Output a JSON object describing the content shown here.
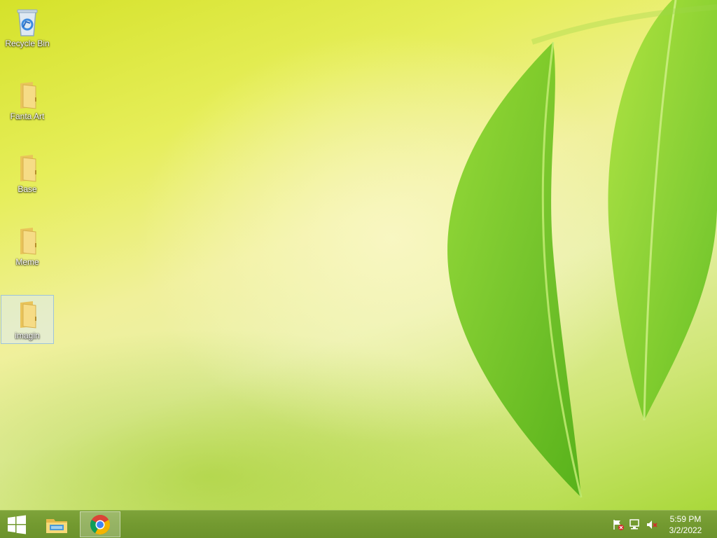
{
  "desktop": {
    "icons": [
      {
        "label": "Recycle Bin",
        "icon": "recycle-bin-icon",
        "selected": false
      },
      {
        "label": "Fanta Art",
        "icon": "folder-icon",
        "selected": false
      },
      {
        "label": "Base",
        "icon": "folder-icon",
        "selected": false
      },
      {
        "label": "Meme",
        "icon": "folder-icon",
        "selected": false
      },
      {
        "label": "imagin",
        "icon": "folder-icon",
        "selected": true
      }
    ]
  },
  "taskbar": {
    "pinned": [
      {
        "icon": "windows-start-icon"
      },
      {
        "icon": "file-explorer-icon"
      },
      {
        "icon": "chrome-icon",
        "active": true
      }
    ],
    "tray": [
      {
        "icon": "action-center-flag-icon"
      },
      {
        "icon": "network-icon"
      },
      {
        "icon": "speaker-muted-icon"
      }
    ],
    "clock": {
      "time": "5:59 PM",
      "date": "3/2/2022"
    }
  },
  "colors": {
    "taskbar": "#739a30",
    "accent": "#7ea33a"
  }
}
